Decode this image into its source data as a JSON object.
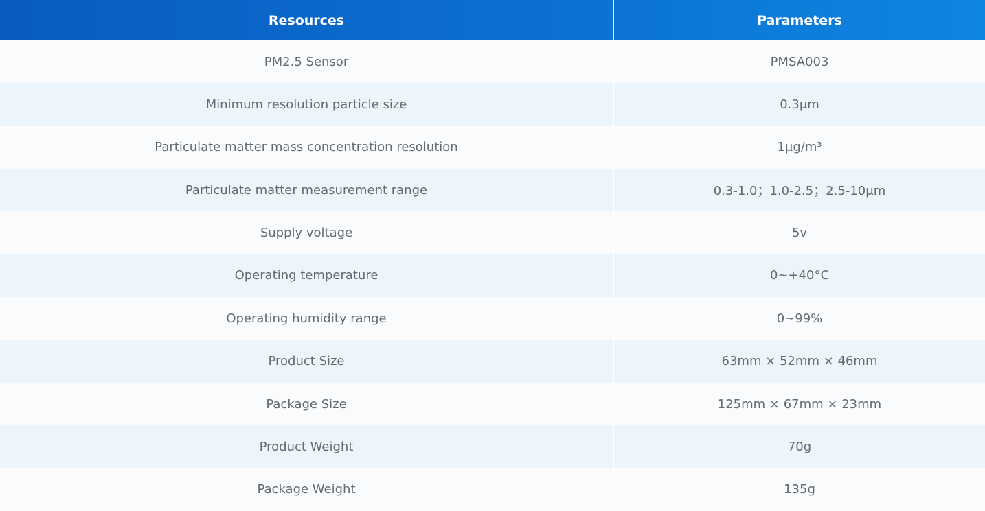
{
  "table": {
    "headers": {
      "resources": "Resources",
      "parameters": "Parameters"
    },
    "rows": [
      {
        "resource": "PM2.5 Sensor",
        "parameter": "PMSA003"
      },
      {
        "resource": "Minimum resolution particle size",
        "parameter": "0.3μm"
      },
      {
        "resource": "Particulate matter mass concentration resolution",
        "parameter": "1μg/m³"
      },
      {
        "resource": "Particulate matter measurement range",
        "parameter": "0.3-1.0；1.0-2.5；2.5-10μm"
      },
      {
        "resource": "Supply voltage",
        "parameter": "5v"
      },
      {
        "resource": "Operating temperature",
        "parameter": "0~+40°C"
      },
      {
        "resource": "Operating humidity range",
        "parameter": "0~99%"
      },
      {
        "resource": "Product Size",
        "parameter": "63mm × 52mm × 46mm"
      },
      {
        "resource": "Package Size",
        "parameter": "125mm × 67mm × 23mm"
      },
      {
        "resource": "Product Weight",
        "parameter": "70g"
      },
      {
        "resource": "Package Weight",
        "parameter": "135g"
      }
    ]
  },
  "colors": {
    "header_gradient_start": "#0a5cbf",
    "header_gradient_end": "#0f86e0",
    "row_light": "#f9fbfd",
    "row_tinted": "#edf5fc",
    "body_text": "#666b70"
  }
}
